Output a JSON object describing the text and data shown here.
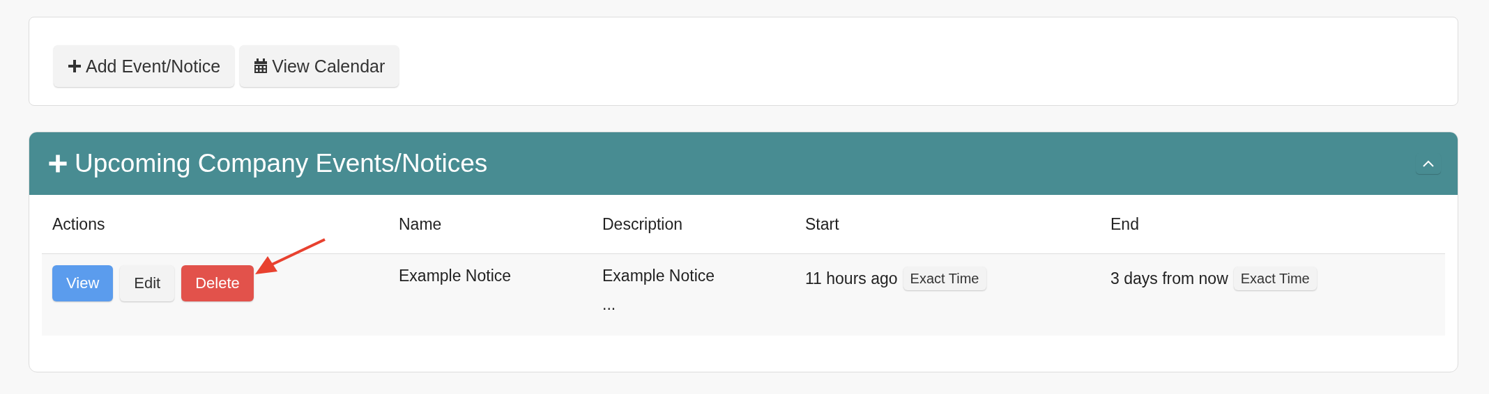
{
  "toolbar": {
    "buttons": [
      {
        "label": "Add Event/Notice",
        "kind": "add"
      },
      {
        "label": "View Calendar",
        "kind": "calendar"
      }
    ]
  },
  "panel": {
    "title": "Upcoming Company Events/Notices",
    "expanded": true,
    "table": {
      "columns": [
        "Actions",
        "Name",
        "Description",
        "Start",
        "End"
      ],
      "rows": [
        {
          "actions": [
            {
              "label": "View",
              "kind": "primary"
            },
            {
              "label": "Edit",
              "kind": "default"
            },
            {
              "label": "Delete",
              "kind": "danger"
            }
          ],
          "name": "Example Notice",
          "description": [
            "Example Notice",
            "..."
          ],
          "start": {
            "text": "11 hours ago",
            "button": "Exact Time"
          },
          "end": {
            "text": "3 days from now",
            "button": "Exact Time"
          }
        }
      ]
    }
  }
}
